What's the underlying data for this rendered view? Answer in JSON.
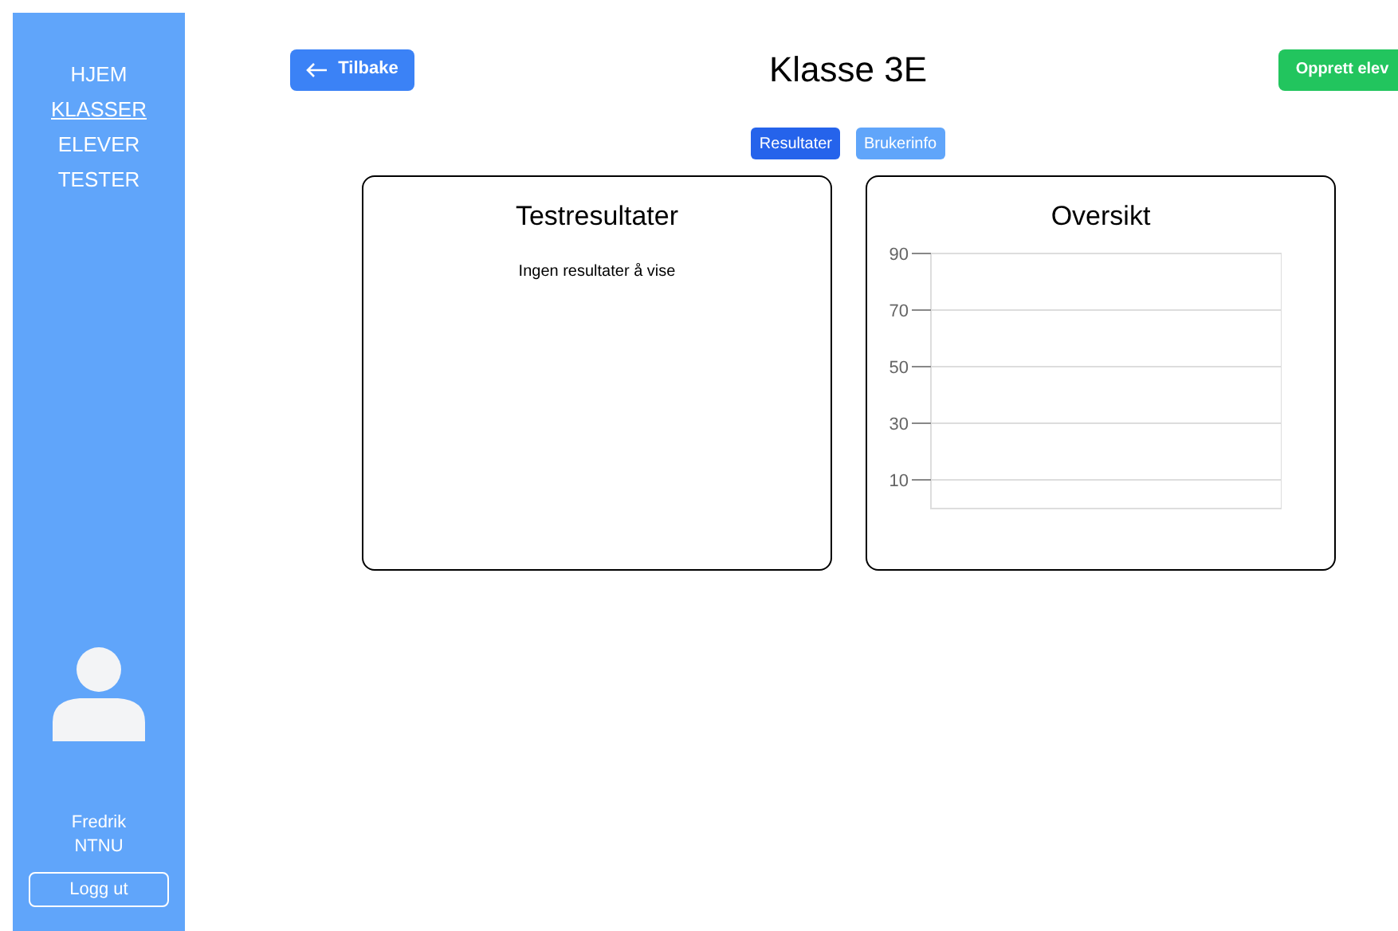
{
  "sidebar": {
    "items": [
      {
        "label": "HJEM",
        "selected": false
      },
      {
        "label": "KLASSER",
        "selected": true
      },
      {
        "label": "ELEVER",
        "selected": false
      },
      {
        "label": "TESTER",
        "selected": false
      }
    ],
    "user": {
      "name": "Fredrik",
      "org": "NTNU"
    },
    "logout": "Logg ut"
  },
  "header": {
    "back": "Tilbake",
    "title": "Klasse 3E",
    "create": "Opprett elev"
  },
  "tabs": [
    {
      "label": "Resultater",
      "selected": true
    },
    {
      "label": "Brukerinfo",
      "selected": false
    }
  ],
  "results": {
    "title": "Testresultater",
    "empty": "Ingen resultater å vise"
  },
  "overview": {
    "title": "Oversikt",
    "chart": {
      "y_axis_labels": [
        "90",
        "70",
        "50",
        "30",
        "10"
      ]
    }
  }
}
